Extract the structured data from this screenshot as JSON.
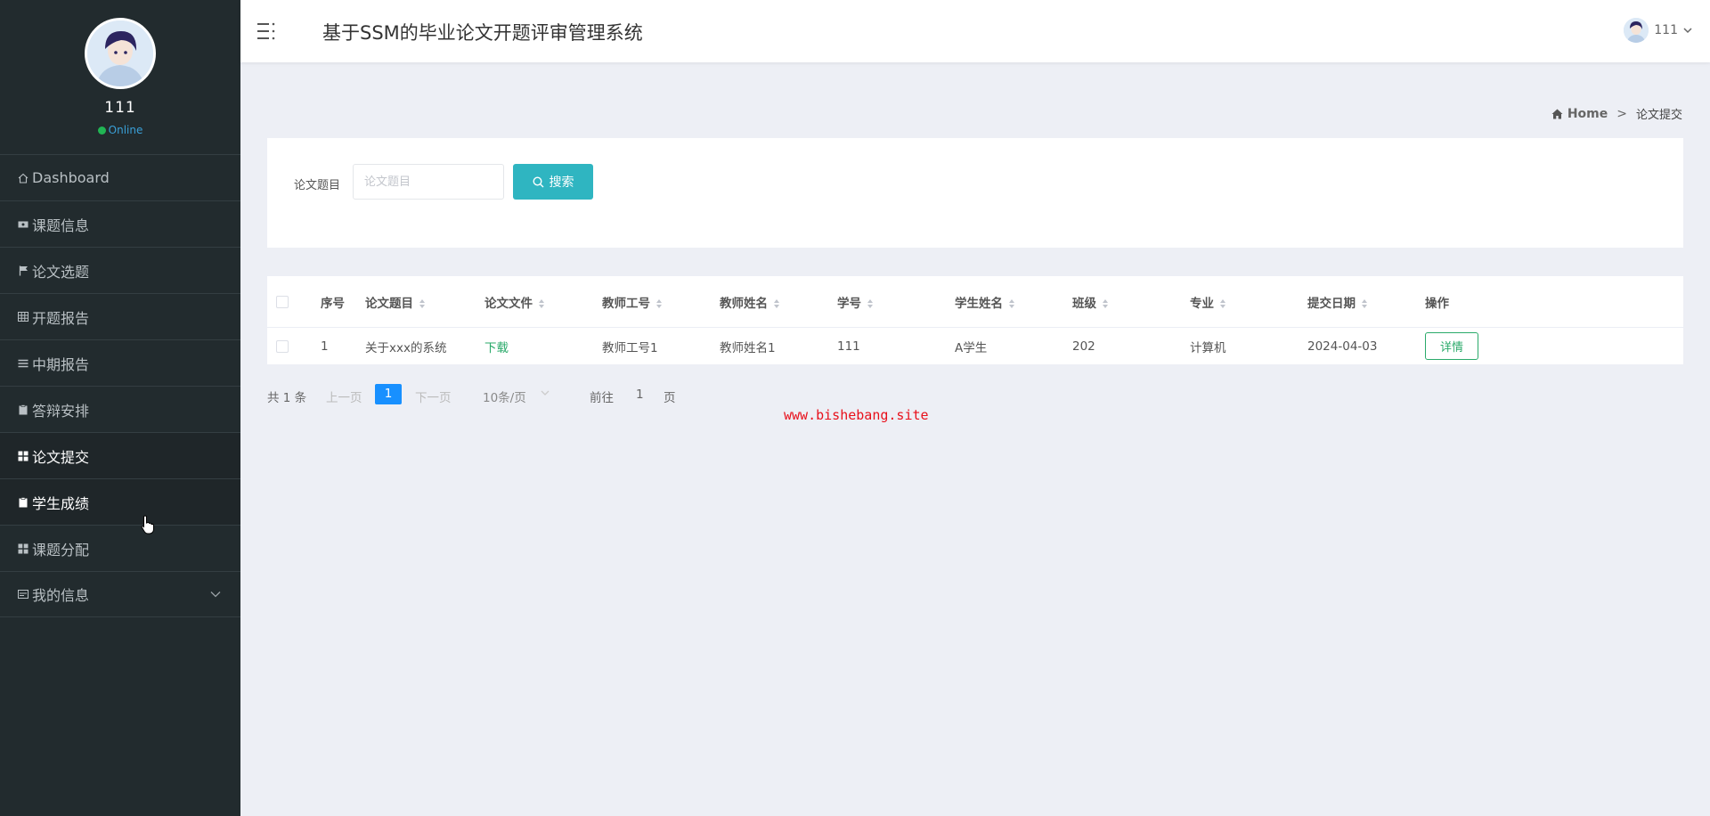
{
  "sidebar": {
    "profile": {
      "name": "111",
      "status": "Online"
    },
    "items": [
      {
        "label": "Dashboard",
        "icon": "home-icon"
      },
      {
        "label": "课题信息",
        "icon": "ticket-icon"
      },
      {
        "label": "论文选题",
        "icon": "flag-icon"
      },
      {
        "label": "开题报告",
        "icon": "grid-table-icon"
      },
      {
        "label": "中期报告",
        "icon": "list-lines-icon"
      },
      {
        "label": "答辩安排",
        "icon": "clipboard-icon"
      },
      {
        "label": "论文提交",
        "icon": "apps-icon"
      },
      {
        "label": "学生成绩",
        "icon": "clipboard-icon"
      },
      {
        "label": "课题分配",
        "icon": "apps-icon"
      },
      {
        "label": "我的信息",
        "icon": "id-card-icon"
      }
    ]
  },
  "header": {
    "title": "基于SSM的毕业论文开题评审管理系统",
    "user": "111"
  },
  "breadcrumb": {
    "home": "Home",
    "separator": ">",
    "current": "论文提交"
  },
  "search": {
    "label": "论文题目",
    "placeholder": "论文题目",
    "value": "",
    "button": "搜索"
  },
  "table": {
    "columns": [
      "序号",
      "论文题目",
      "论文文件",
      "教师工号",
      "教师姓名",
      "学号",
      "学生姓名",
      "班级",
      "专业",
      "提交日期",
      "操作"
    ],
    "rows": [
      {
        "index": "1",
        "title": "关于xxx的系统",
        "file": "下载",
        "teacher_id": "教师工号1",
        "teacher_name": "教师姓名1",
        "student_id": "111",
        "student_name": "A学生",
        "class": "202",
        "major": "计算机",
        "date": "2024-04-03",
        "action": "详情"
      }
    ]
  },
  "pagination": {
    "total": "共 1 条",
    "prev": "上一页",
    "current": "1",
    "next": "下一页",
    "page_size": "10条/页",
    "goto": "前往",
    "jump_value": "1",
    "unit": "页"
  },
  "watermark": "www.bishebang.site",
  "colors": {
    "sidebar_bg": "#222b2e",
    "accent": "#2fb5c1",
    "link_green": "#2aaa6a",
    "page_active": "#1890ff",
    "watermark": "#e8101b"
  }
}
